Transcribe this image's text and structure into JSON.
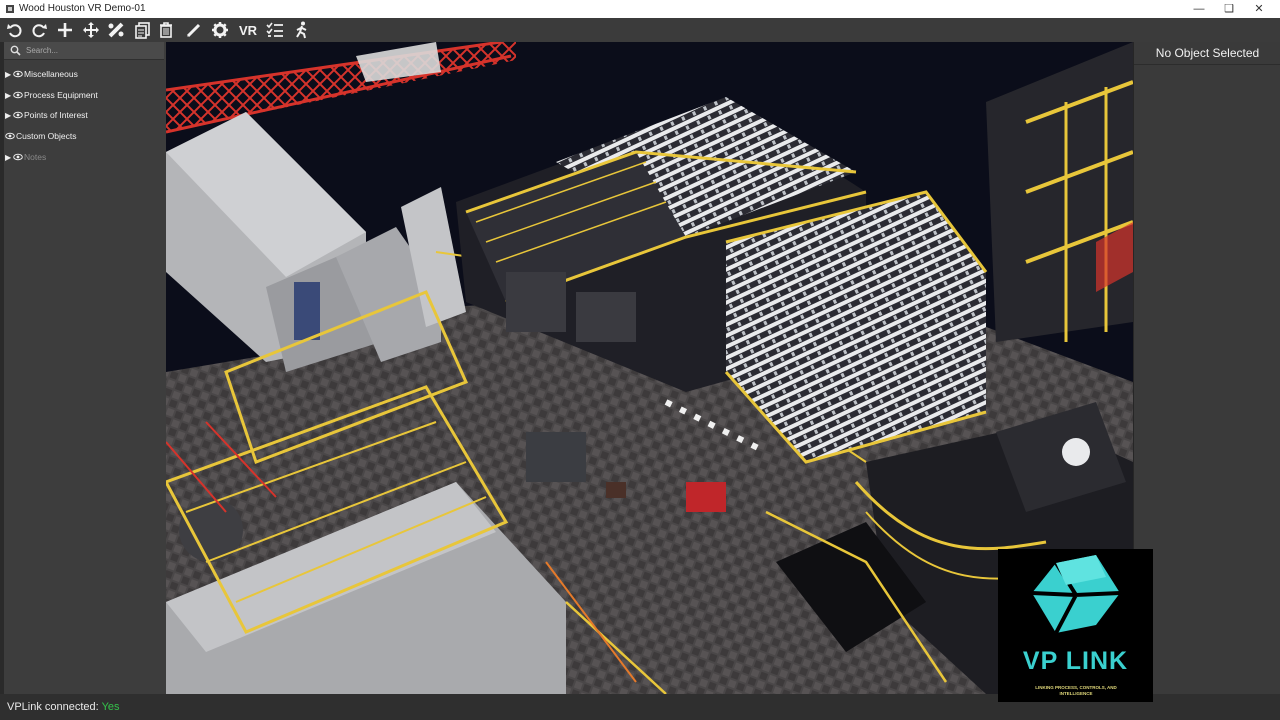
{
  "window": {
    "title": "Wood Houston VR Demo-01",
    "controls": [
      "minimize",
      "restore",
      "close"
    ]
  },
  "toolbar": {
    "buttons": [
      {
        "name": "undo-icon"
      },
      {
        "name": "redo-icon"
      },
      {
        "name": "add-icon"
      },
      {
        "name": "move-icon"
      },
      {
        "name": "measure-icon"
      },
      {
        "name": "copy-icon"
      },
      {
        "name": "delete-icon"
      },
      {
        "name": "pen-icon"
      },
      {
        "name": "gear-icon"
      },
      {
        "name": "vr-button",
        "label": "VR"
      },
      {
        "name": "checklist-icon"
      },
      {
        "name": "walk-icon"
      }
    ]
  },
  "sidebar": {
    "search_placeholder": "Search...",
    "items": [
      {
        "label": "Miscellaneous",
        "expandable": true,
        "dim": false
      },
      {
        "label": "Process Equipment",
        "expandable": true,
        "dim": false
      },
      {
        "label": "Points of Interest",
        "expandable": true,
        "dim": false
      },
      {
        "label": "Custom Objects",
        "expandable": false,
        "dim": false
      },
      {
        "label": "Notes",
        "expandable": true,
        "dim": true
      }
    ]
  },
  "inspector": {
    "header": "No Object Selected"
  },
  "status": {
    "label": "VPLink connected:",
    "value": "Yes",
    "value_color": "#34c24a"
  },
  "logo": {
    "brand": "VP LINK",
    "tagline": "LINKING PROCESS, CONTROLS, AND INTELLIGENCE",
    "color": "#3ad0cf"
  },
  "colors": {
    "accent_yellow": "#e8c63a",
    "accent_red": "#d6332b",
    "background": "#3a3a3a"
  }
}
